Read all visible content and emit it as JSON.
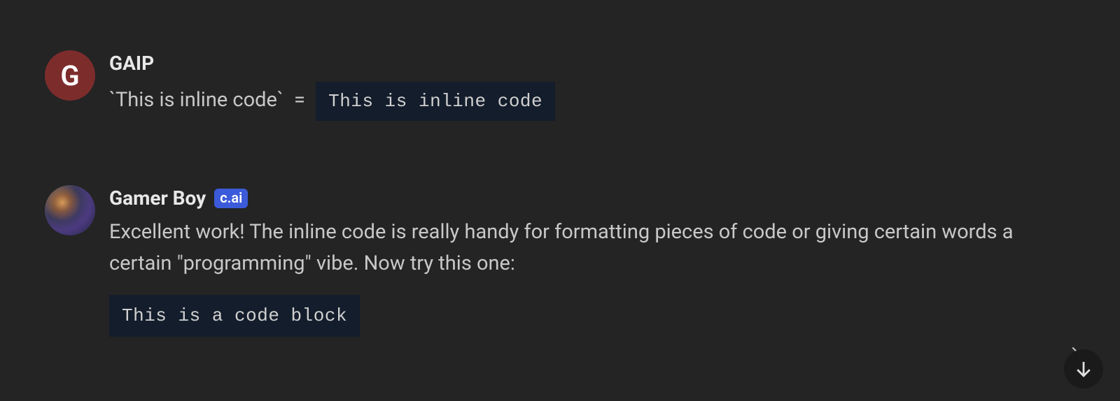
{
  "messages": [
    {
      "author": "GAIP",
      "avatar_letter": "G",
      "inline_raw": "`This is inline code`",
      "equals": "=",
      "inline_code": "This is inline code"
    },
    {
      "author": "Gamer Boy",
      "badge": "c.ai",
      "text": "Excellent work! The inline code is really handy for formatting pieces of code or giving certain words a certain \"programming\" vibe. Now try this one:",
      "code_block": "This is a code block"
    }
  ]
}
